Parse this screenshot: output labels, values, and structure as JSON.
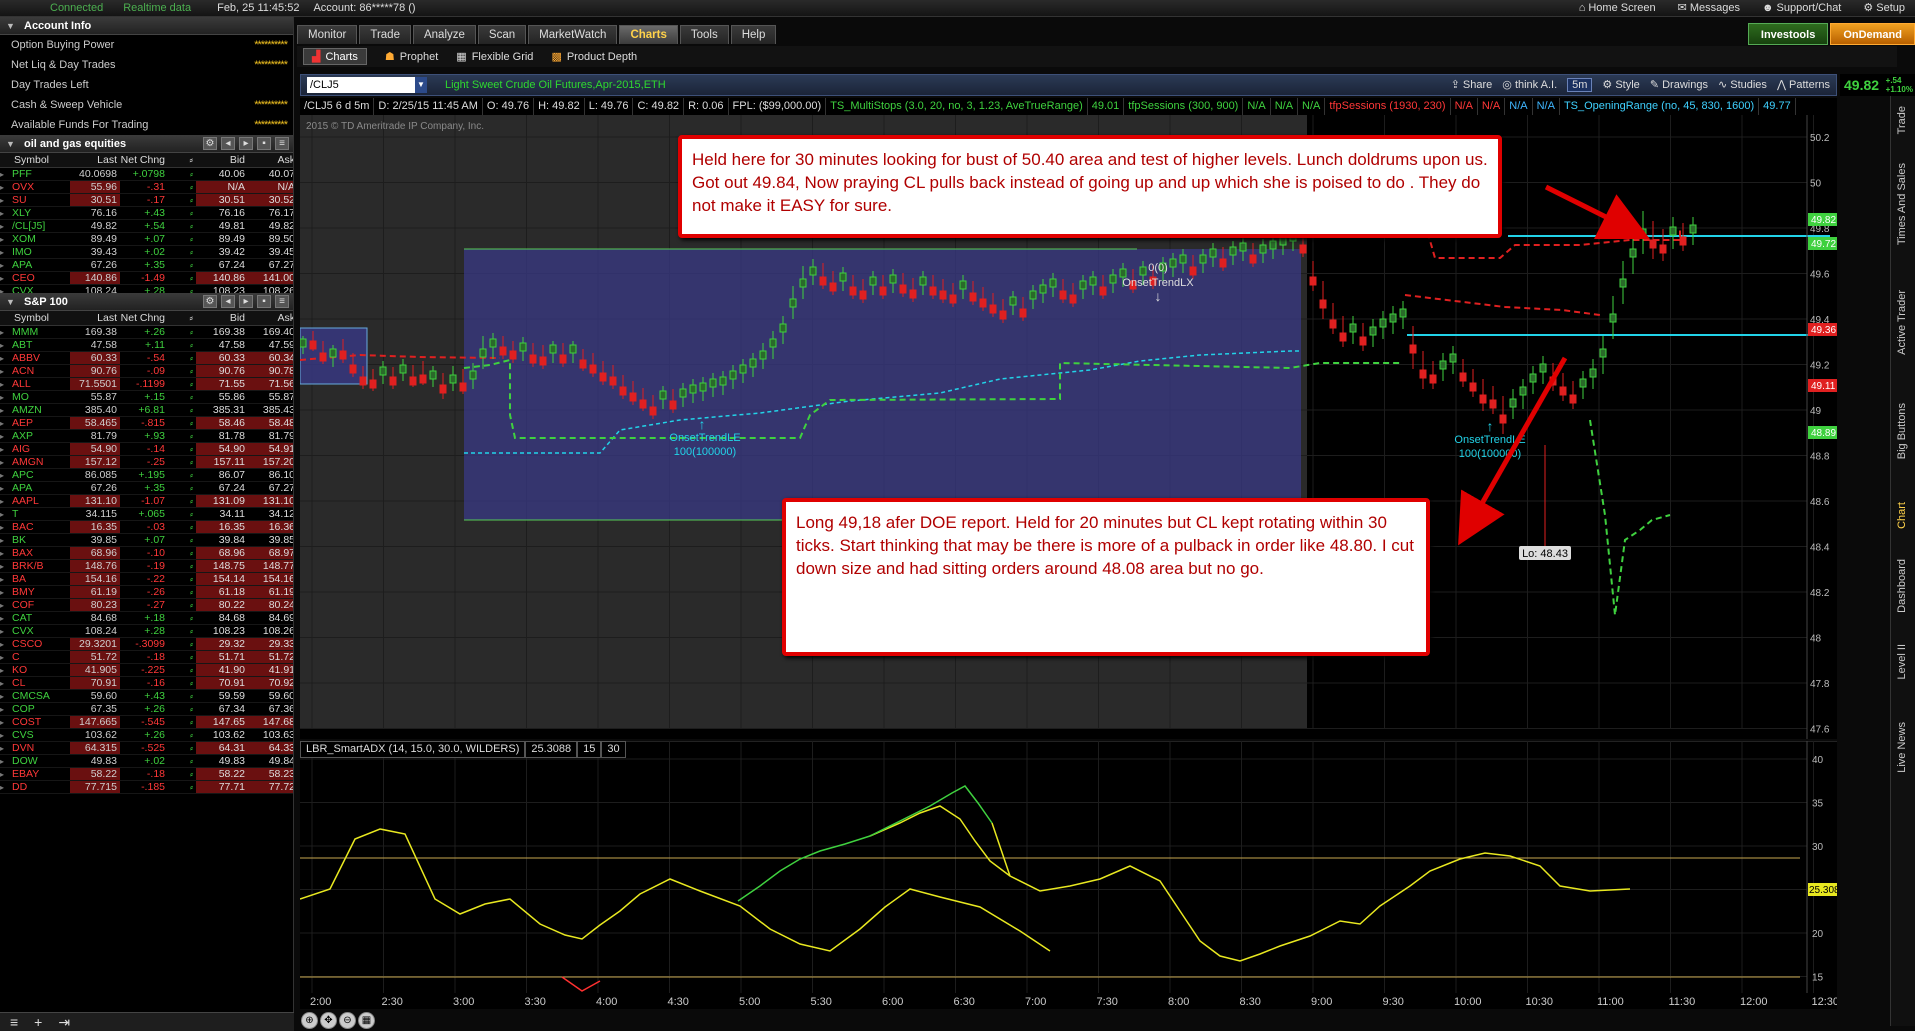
{
  "topbar": {
    "connected": "Connected",
    "realtime": "Realtime data",
    "datetime": "Feb, 25  11:45:52",
    "account": "Account: 86*****78 ()",
    "home": "Home Screen",
    "messages": "Messages",
    "support": "Support/Chat",
    "setup": "Setup"
  },
  "account_info": {
    "title": "Account Info",
    "rows": [
      {
        "label": "Option Buying Power",
        "value": "**********"
      },
      {
        "label": "Net Liq & Day Trades",
        "value": "**********"
      },
      {
        "label": "Day Trades Left",
        "value": ""
      },
      {
        "label": "Cash & Sweep Vehicle",
        "value": "**********"
      },
      {
        "label": "Available Funds For Trading",
        "value": "**********"
      }
    ]
  },
  "watchlist1": {
    "title": "oil and gas equities",
    "columns": [
      "Symbol",
      "Last",
      "Net Chng",
      "",
      "Bid",
      "Ask"
    ],
    "rows": [
      {
        "sym": "PFF",
        "last": "40.0698",
        "chg": "+.0798",
        "bid": "40.06",
        "ask": "40.07",
        "dir": "up",
        "lastred": true
      },
      {
        "sym": "OVX",
        "last": "55.96",
        "chg": "-.31",
        "bid": "N/A",
        "ask": "N/A",
        "dir": "dn"
      },
      {
        "sym": "SU",
        "last": "30.51",
        "chg": "-.17",
        "bid": "30.51",
        "ask": "30.52",
        "dir": "dn"
      },
      {
        "sym": "XLY",
        "last": "76.16",
        "chg": "+.43",
        "bid": "76.16",
        "ask": "76.17",
        "dir": "up"
      },
      {
        "sym": "/CL[J5]",
        "last": "49.82",
        "chg": "+.54",
        "bid": "49.81",
        "ask": "49.82",
        "dir": "up"
      },
      {
        "sym": "XOM",
        "last": "89.49",
        "chg": "+.07",
        "bid": "89.49",
        "ask": "89.50",
        "dir": "up"
      },
      {
        "sym": "IMO",
        "last": "39.43",
        "chg": "+.02",
        "bid": "39.42",
        "ask": "39.45",
        "dir": "up"
      },
      {
        "sym": "APA",
        "last": "67.26",
        "chg": "+.35",
        "bid": "67.24",
        "ask": "67.27",
        "dir": "up"
      },
      {
        "sym": "CEO",
        "last": "140.86",
        "chg": "-1.49",
        "bid": "140.86",
        "ask": "141.00",
        "dir": "dn"
      },
      {
        "sym": "CVX",
        "last": "108.24",
        "chg": "+.28",
        "bid": "108.23",
        "ask": "108.26",
        "dir": "up"
      }
    ]
  },
  "watchlist2": {
    "title": "S&P 100",
    "columns": [
      "Symbol",
      "Last",
      "Net Chng",
      "",
      "Bid",
      "Ask"
    ],
    "rows": [
      {
        "sym": "MMM",
        "last": "169.38",
        "chg": "+.26",
        "bid": "169.38",
        "ask": "169.40",
        "dir": "up"
      },
      {
        "sym": "ABT",
        "last": "47.58",
        "chg": "+.11",
        "bid": "47.58",
        "ask": "47.59",
        "dir": "up"
      },
      {
        "sym": "ABBV",
        "last": "60.33",
        "chg": "-.54",
        "bid": "60.33",
        "ask": "60.34",
        "dir": "dn"
      },
      {
        "sym": "ACN",
        "last": "90.76",
        "chg": "-.09",
        "bid": "90.76",
        "ask": "90.78",
        "dir": "dn"
      },
      {
        "sym": "ALL",
        "last": "71.5501",
        "chg": "-.1199",
        "bid": "71.55",
        "ask": "71.56",
        "dir": "dn"
      },
      {
        "sym": "MO",
        "last": "55.87",
        "chg": "+.15",
        "bid": "55.86",
        "ask": "55.87",
        "dir": "up"
      },
      {
        "sym": "AMZN",
        "last": "385.40",
        "chg": "+6.81",
        "bid": "385.31",
        "ask": "385.43",
        "dir": "up"
      },
      {
        "sym": "AEP",
        "last": "58.465",
        "chg": "-.815",
        "bid": "58.46",
        "ask": "58.48",
        "dir": "dn"
      },
      {
        "sym": "AXP",
        "last": "81.79",
        "chg": "+.93",
        "bid": "81.78",
        "ask": "81.79",
        "dir": "up"
      },
      {
        "sym": "AIG",
        "last": "54.90",
        "chg": "-.14",
        "bid": "54.90",
        "ask": "54.91",
        "dir": "dn"
      },
      {
        "sym": "AMGN",
        "last": "157.12",
        "chg": "-.25",
        "bid": "157.11",
        "ask": "157.20",
        "dir": "dn"
      },
      {
        "sym": "APC",
        "last": "86.085",
        "chg": "+.195",
        "bid": "86.07",
        "ask": "86.10",
        "dir": "up"
      },
      {
        "sym": "APA",
        "last": "67.26",
        "chg": "+.35",
        "bid": "67.24",
        "ask": "67.27",
        "dir": "up"
      },
      {
        "sym": "AAPL",
        "last": "131.10",
        "chg": "-1.07",
        "bid": "131.09",
        "ask": "131.10",
        "dir": "dn"
      },
      {
        "sym": "T",
        "last": "34.115",
        "chg": "+.065",
        "bid": "34.11",
        "ask": "34.12",
        "dir": "up"
      },
      {
        "sym": "BAC",
        "last": "16.35",
        "chg": "-.03",
        "bid": "16.35",
        "ask": "16.36",
        "dir": "dn"
      },
      {
        "sym": "BK",
        "last": "39.85",
        "chg": "+.07",
        "bid": "39.84",
        "ask": "39.85",
        "dir": "up"
      },
      {
        "sym": "BAX",
        "last": "68.96",
        "chg": "-.10",
        "bid": "68.96",
        "ask": "68.97",
        "dir": "dn"
      },
      {
        "sym": "BRK/B",
        "last": "148.76",
        "chg": "-.19",
        "bid": "148.75",
        "ask": "148.77",
        "dir": "dn"
      },
      {
        "sym": "BA",
        "last": "154.16",
        "chg": "-.22",
        "bid": "154.14",
        "ask": "154.16",
        "dir": "dn"
      },
      {
        "sym": "BMY",
        "last": "61.19",
        "chg": "-.26",
        "bid": "61.18",
        "ask": "61.19",
        "dir": "dn"
      },
      {
        "sym": "COF",
        "last": "80.23",
        "chg": "-.27",
        "bid": "80.22",
        "ask": "80.24",
        "dir": "dn"
      },
      {
        "sym": "CAT",
        "last": "84.68",
        "chg": "+.18",
        "bid": "84.68",
        "ask": "84.69",
        "dir": "up"
      },
      {
        "sym": "CVX",
        "last": "108.24",
        "chg": "+.28",
        "bid": "108.23",
        "ask": "108.26",
        "dir": "up"
      },
      {
        "sym": "CSCO",
        "last": "29.3201",
        "chg": "-.3099",
        "bid": "29.32",
        "ask": "29.33",
        "dir": "dn"
      },
      {
        "sym": "C",
        "last": "51.72",
        "chg": "-.18",
        "bid": "51.71",
        "ask": "51.72",
        "dir": "dn"
      },
      {
        "sym": "KO",
        "last": "41.905",
        "chg": "-.225",
        "bid": "41.90",
        "ask": "41.91",
        "dir": "dn"
      },
      {
        "sym": "CL",
        "last": "70.91",
        "chg": "-.16",
        "bid": "70.91",
        "ask": "70.92",
        "dir": "dn"
      },
      {
        "sym": "CMCSA",
        "last": "59.60",
        "chg": "+.43",
        "bid": "59.59",
        "ask": "59.60",
        "dir": "up"
      },
      {
        "sym": "COP",
        "last": "67.35",
        "chg": "+.26",
        "bid": "67.34",
        "ask": "67.36",
        "dir": "up"
      },
      {
        "sym": "COST",
        "last": "147.665",
        "chg": "-.545",
        "bid": "147.65",
        "ask": "147.68",
        "dir": "dn"
      },
      {
        "sym": "CVS",
        "last": "103.62",
        "chg": "+.26",
        "bid": "103.62",
        "ask": "103.63",
        "dir": "up"
      },
      {
        "sym": "DVN",
        "last": "64.315",
        "chg": "-.525",
        "bid": "64.31",
        "ask": "64.33",
        "dir": "dn"
      },
      {
        "sym": "DOW",
        "last": "49.83",
        "chg": "+.02",
        "bid": "49.83",
        "ask": "49.84",
        "dir": "up"
      },
      {
        "sym": "EBAY",
        "last": "58.22",
        "chg": "-.18",
        "bid": "58.22",
        "ask": "58.23",
        "dir": "dn"
      },
      {
        "sym": "DD",
        "last": "77.715",
        "chg": "-.185",
        "bid": "77.71",
        "ask": "77.72",
        "dir": "dn"
      }
    ]
  },
  "tabs": [
    "Monitor",
    "Trade",
    "Analyze",
    "Scan",
    "MarketWatch",
    "Charts",
    "Tools",
    "Help"
  ],
  "active_tab": "Charts",
  "right_buttons": {
    "investools": "Investools",
    "ondemand": "OnDemand"
  },
  "subtabs": [
    "Charts",
    "Prophet",
    "Flexible Grid",
    "Product Depth"
  ],
  "chart": {
    "symbol": "/CLJ5",
    "description": "Light Sweet Crude Oil Futures,Apr-2015,ETH",
    "last": "49.82",
    "change_top": "+.54",
    "change_bottom": "+1.10%",
    "toolbar": [
      "Share",
      "think A.I.",
      "5m",
      "Style",
      "Drawings",
      "Studies",
      "Patterns"
    ],
    "strip": [
      {
        "t": "/CLJ5 6 d 5m",
        "c": "#ddd"
      },
      {
        "t": "D: 2/25/15 11:45 AM",
        "c": "#ddd"
      },
      {
        "t": "O: 49.76",
        "c": "#ddd"
      },
      {
        "t": "H: 49.82",
        "c": "#ddd"
      },
      {
        "t": "L: 49.76",
        "c": "#ddd"
      },
      {
        "t": "C: 49.82",
        "c": "#ddd"
      },
      {
        "t": "R: 0.06",
        "c": "#ddd"
      },
      {
        "t": "FPL: ($99,000.00)",
        "c": "#ddd"
      },
      {
        "t": "TS_MultiStops (3.0, 20, no, 3, 1.23, AveTrueRange)",
        "c": "#3fd13f"
      },
      {
        "t": "49.01",
        "c": "#3fd13f"
      },
      {
        "t": "tfpSessions (300, 900)",
        "c": "#3fd13f"
      },
      {
        "t": "N/A",
        "c": "#3fd13f"
      },
      {
        "t": "N/A",
        "c": "#3fd13f"
      },
      {
        "t": "N/A",
        "c": "#3fd13f"
      },
      {
        "t": "tfpSessions (1930, 230)",
        "c": "#ff3838"
      },
      {
        "t": "N/A",
        "c": "#ff3838"
      },
      {
        "t": "N/A",
        "c": "#ff3838"
      },
      {
        "t": "N/A",
        "c": "#3fb6ff"
      },
      {
        "t": "N/A",
        "c": "#3fb6ff"
      },
      {
        "t": "TS_OpeningRange (no, 45, 830, 1600)",
        "c": "#3fd1ff"
      },
      {
        "t": "49.77",
        "c": "#3fd1ff"
      }
    ],
    "copyright": "2015 © TD Ameritrade IP Company, Inc.",
    "price_labels": [
      "50.2",
      "50",
      "49.8",
      "49.6",
      "49.4",
      "49.2",
      "49",
      "48.8",
      "48.6",
      "48.4",
      "48.2",
      "48",
      "47.8",
      "47.6"
    ],
    "tag_labels": [
      {
        "v": "49.82",
        "c": "#3fd13f"
      },
      {
        "v": "49.72",
        "c": "#3fd13f"
      },
      {
        "v": "49.36",
        "c": "#e02020"
      },
      {
        "v": "49.11",
        "c": "#e02020"
      },
      {
        "v": "48.89",
        "c": "#3fd13f"
      }
    ],
    "signals": {
      "le": "OnsetTrendLE",
      "le_qty": "100(100000)",
      "lx": "OnsetTrendLX",
      "lx_qty": "0(0)",
      "le2": "OnsetTrendLE",
      "le2_qty": "100(100000)",
      "lo": "Lo: 48.43"
    },
    "time_labels": [
      "2:00",
      "2:30",
      "3:00",
      "3:30",
      "4:00",
      "4:30",
      "5:00",
      "5:30",
      "6:00",
      "6:30",
      "7:00",
      "7:30",
      "8:00",
      "8:30",
      "9:00",
      "9:30",
      "10:00",
      "10:30",
      "11:00",
      "11:30",
      "12:00",
      "12:30"
    ]
  },
  "oscillator": {
    "name": "LBR_SmartADX (14, 15.0, 30.0, WILDERS)",
    "value": "25.3088",
    "lvl1": "15",
    "lvl2": "30",
    "axis": [
      "40",
      "35",
      "30",
      "25",
      "20",
      "15"
    ],
    "tag": "25.3089"
  },
  "notes": {
    "note1": "Held here for 30 minutes  looking for bust of 50.40 area and test of higher levels. Lunch doldrums upon us. Got out 49.84, Now praying CL pulls back instead of going up and up which she is poised to do . They do not make it EASY for sure.",
    "note2": "Long 49,18 afer DOE report. Held for 20 minutes but CL kept rotating within 30 ticks. Start thinking that may be there is more of a pulback in order like 48.80. I cut down size and had sitting orders around 48.08 area but no go."
  },
  "sidebar_right": [
    "Trade",
    "Times And Sales",
    "Active Trader",
    "Big Buttons",
    "Chart",
    "Dashboard",
    "Level II",
    "Live News"
  ]
}
